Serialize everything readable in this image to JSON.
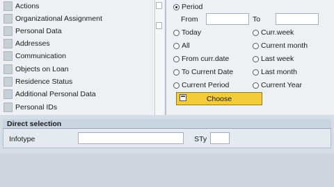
{
  "infotype_list": {
    "items": [
      {
        "label": "Actions"
      },
      {
        "label": "Organizational Assignment"
      },
      {
        "label": "Personal Data"
      },
      {
        "label": "Addresses"
      },
      {
        "label": "Communication"
      },
      {
        "label": "Objects on Loan"
      },
      {
        "label": "Residence Status"
      },
      {
        "label": "Additional Personal Data"
      },
      {
        "label": "Personal IDs"
      }
    ]
  },
  "period": {
    "period_label": "Period",
    "from_label": "From",
    "to_label": "To",
    "from_value": "",
    "to_value": "",
    "selected": "Period",
    "options_left": [
      "Today",
      "All",
      "From curr.date",
      "To Current Date",
      "Current Period"
    ],
    "options_right": [
      "Curr.week",
      "Current month",
      "Last week",
      "Last month",
      "Current Year"
    ],
    "choose_label": "Choose"
  },
  "direct_selection": {
    "title": "Direct selection",
    "infotype_label": "Infotype",
    "infotype_value": "",
    "sty_label": "STy",
    "sty_value": ""
  },
  "colors": {
    "choose_button": "#f4cc3a",
    "section_header": "#c9d4e1"
  }
}
